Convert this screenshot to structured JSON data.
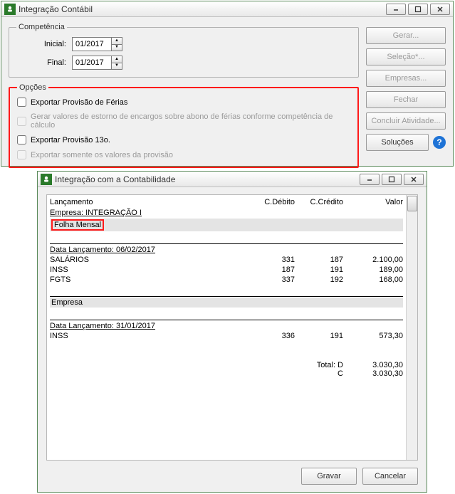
{
  "win1": {
    "title": "Integração Contábil",
    "competencia": {
      "legend": "Competência",
      "inicial_label": "Inicial:",
      "inicial_value": "01/2017",
      "final_label": "Final:",
      "final_value": "01/2017"
    },
    "opcoes": {
      "legend": "Opções",
      "chk1": "Exportar Provisão de Férias",
      "chk2": "Gerar valores de estorno de encargos sobre abono de férias conforme competência de cálculo",
      "chk3": "Exportar Provisão 13o.",
      "chk4": "Exportar somente os valores da provisão"
    },
    "buttons": {
      "gerar": "Gerar...",
      "selecao": "Seleção*...",
      "empresas": "Empresas...",
      "fechar": "Fechar",
      "concluir": "Concluir Atividade...",
      "solucoes": "Soluções"
    }
  },
  "win2": {
    "title": "Integração com a Contabilidade",
    "headers": {
      "lanc": "Lançamento",
      "debito": "C.Débito",
      "credito": "C.Crédito",
      "valor": "Valor"
    },
    "empresa_line": "Empresa:   INTEGRAÇÃO I",
    "section1": "Folha Mensal",
    "data1_label": "Data Lançamento: 06/02/2017",
    "rows1": [
      {
        "l": "SALÁRIOS",
        "d": "331",
        "c": "187",
        "v": "2.100,00"
      },
      {
        "l": "INSS",
        "d": "187",
        "c": "191",
        "v": "189,00"
      },
      {
        "l": "FGTS",
        "d": "337",
        "c": "192",
        "v": "168,00"
      }
    ],
    "section2": "Empresa",
    "data2_label": "Data Lançamento: 31/01/2017",
    "rows2": [
      {
        "l": "INSS",
        "d": "336",
        "c": "191",
        "v": "573,30"
      }
    ],
    "totals": {
      "d_label": "Total: D",
      "d_value": "3.030,30",
      "c_label": "C",
      "c_value": "3.030,30"
    },
    "buttons": {
      "gravar": "Gravar",
      "cancelar": "Cancelar"
    }
  }
}
